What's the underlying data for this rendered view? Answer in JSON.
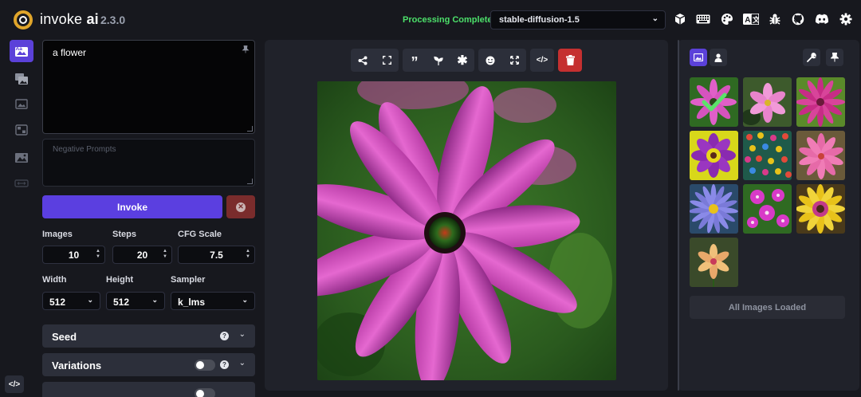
{
  "header": {
    "app_name": "invoke",
    "app_name_bold": "ai",
    "version": "2.3.0",
    "status": "Processing Complete",
    "model": "stable-diffusion-1.5",
    "icons": [
      "cube-icon",
      "keyboard-icon",
      "palette-icon",
      "language-icon",
      "bug-icon",
      "github-icon",
      "discord-icon",
      "settings-icon"
    ]
  },
  "left_nav": {
    "items": [
      "text-to-image",
      "image-to-image",
      "unified-canvas",
      "nodes",
      "postprocessing",
      "training"
    ],
    "active": "text-to-image"
  },
  "prompt": {
    "value": "a flower",
    "negative_placeholder": "Negative Prompts"
  },
  "actions": {
    "invoke_label": "Invoke"
  },
  "params": {
    "images_label": "Images",
    "images_value": "10",
    "steps_label": "Steps",
    "steps_value": "20",
    "cfg_label": "CFG Scale",
    "cfg_value": "7.5",
    "width_label": "Width",
    "width_value": "512",
    "height_label": "Height",
    "height_value": "512",
    "sampler_label": "Sampler",
    "sampler_value": "k_lms"
  },
  "accordions": {
    "seed": "Seed",
    "variations": "Variations"
  },
  "toolbar": {
    "icons": [
      "share-icon",
      "fullscreen-icon",
      "quote-icon",
      "sprout-icon",
      "asterisk-icon",
      "face-restore-icon",
      "upscale-icon",
      "code-icon",
      "trash-icon"
    ]
  },
  "gallery": {
    "all_loaded_label": "All Images Loaded",
    "thumb_count": 10,
    "accent": "#5b41d9"
  },
  "colors": {
    "accent": "#5b41d9",
    "status_green": "#4ce06a",
    "danger": "#c53030"
  }
}
